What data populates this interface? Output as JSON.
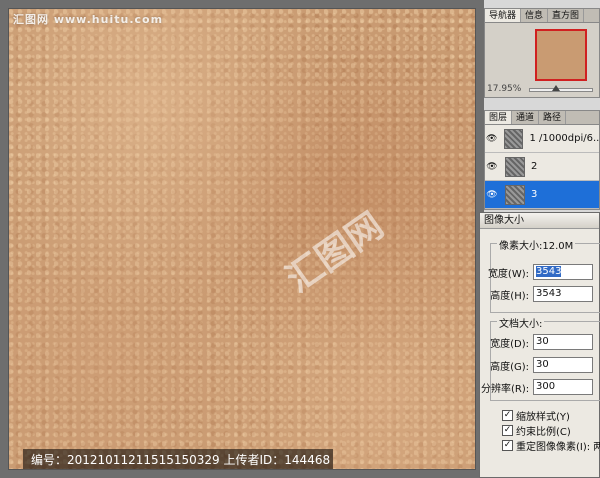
{
  "watermark": {
    "top": "汇图网 www.huitu.com",
    "center": "汇图网"
  },
  "caption": "编号：20121011211515150329 上传者ID：144468",
  "navigator": {
    "tabs": [
      "导航器",
      "信息",
      "直方图"
    ],
    "zoom": "17.95%"
  },
  "layers": {
    "tabs": [
      "图层",
      "通道",
      "路径"
    ],
    "items": [
      {
        "name": "1 /1000dpi/6...",
        "visible": true,
        "selected": false
      },
      {
        "name": "2",
        "visible": true,
        "selected": false
      },
      {
        "name": "3",
        "visible": true,
        "selected": true
      }
    ]
  },
  "dialog": {
    "title": "图像大小",
    "pixel_dimensions": {
      "label": "像素大小:12.0M",
      "width_label": "宽度(W):",
      "width_value": "3543",
      "height_label": "高度(H):",
      "height_value": "3543"
    },
    "document_size": {
      "label": "文档大小:",
      "width_label": "宽度(D):",
      "width_value": "30",
      "height_label": "高度(G):",
      "height_value": "30",
      "resolution_label": "分辨率(R):",
      "resolution_value": "300"
    },
    "checkboxes": [
      {
        "label": "缩放样式(Y)",
        "checked": true
      },
      {
        "label": "约束比例(C)",
        "checked": true
      },
      {
        "label": "重定图像像素(I): 两",
        "checked": true
      }
    ]
  },
  "colors": {
    "selection": "#1e6fd8",
    "texture": "#c99b72",
    "nav_frame": "#d02020"
  }
}
